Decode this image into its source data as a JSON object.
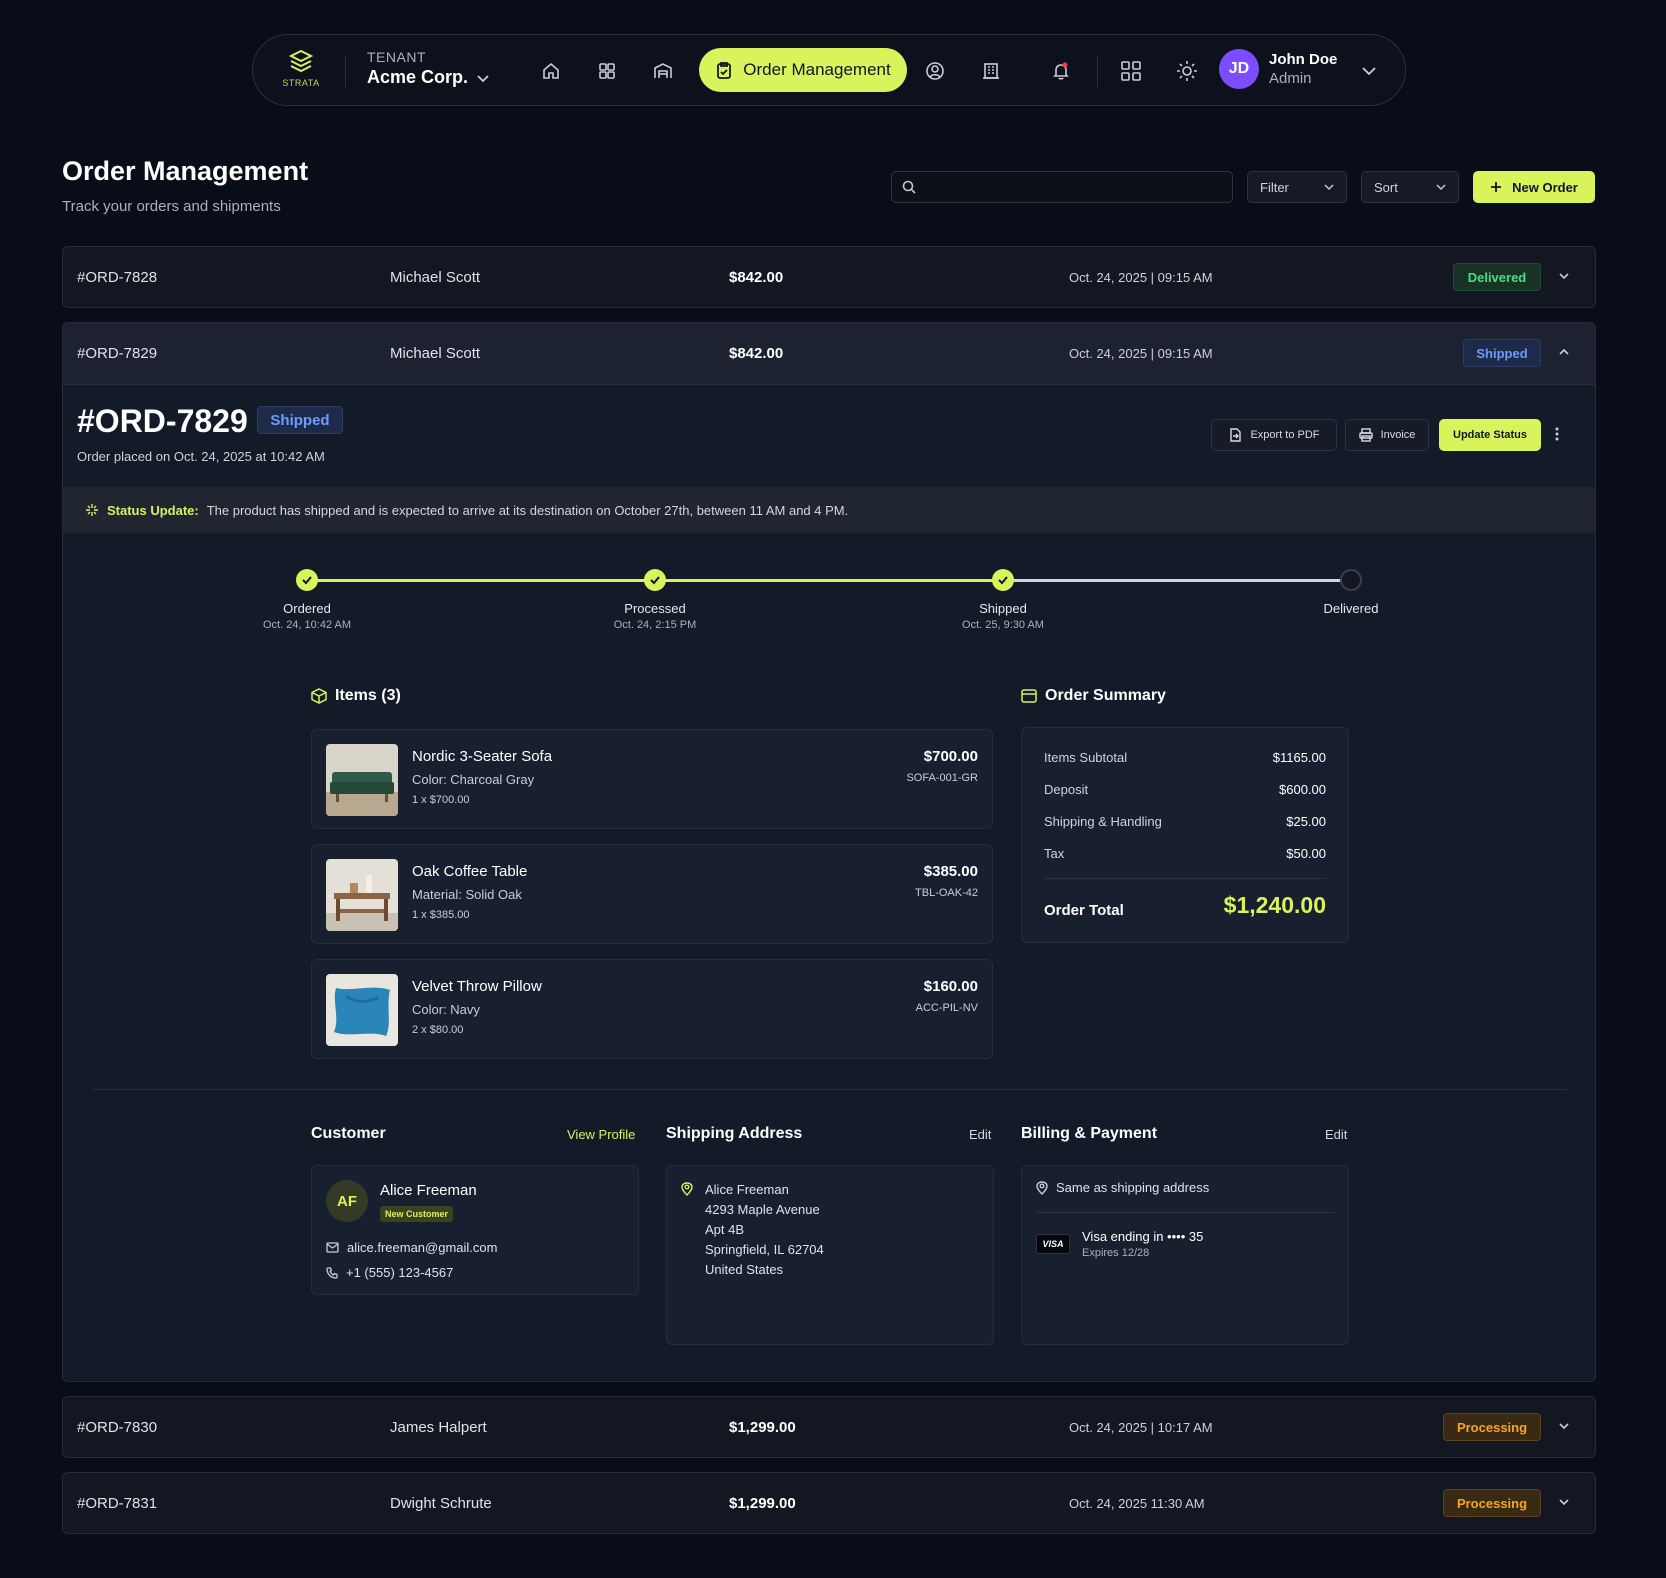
{
  "nav": {
    "logo_text": "STRATA",
    "tenant_label": "TENANT",
    "tenant_name": "Acme Corp.",
    "active_label": "Order Management",
    "user_initials": "JD",
    "user_name": "John Doe",
    "user_role": "Admin",
    "accent": "#d9f35a"
  },
  "page": {
    "title": "Order Management",
    "subtitle": "Track your orders and shipments",
    "search_placeholder": "",
    "filter_label": "Filter",
    "sort_label": "Sort",
    "new_order_label": "New Order"
  },
  "orders": [
    {
      "id": "#ORD-7828",
      "customer": "Michael Scott",
      "amount": "$842.00",
      "date": "Oct. 24, 2025 | 09:15 AM",
      "status": "Delivered"
    },
    {
      "id": "#ORD-7829",
      "customer": "Michael Scott",
      "amount": "$842.00",
      "date": "Oct. 24, 2025 | 09:15 AM",
      "status": "Shipped"
    },
    {
      "id": "#ORD-7830",
      "customer": "James Halpert",
      "amount": "$1,299.00",
      "date": "Oct. 24, 2025 | 10:17 AM",
      "status": "Processing"
    },
    {
      "id": "#ORD-7831",
      "customer": "Dwight Schrute",
      "amount": "$1,299.00",
      "date": "Oct. 24, 2025 11:30 AM",
      "status": "Processing"
    }
  ],
  "detail": {
    "id": "#ORD-7829",
    "status": "Shipped",
    "placed": "Order placed on Oct. 24, 2025 at 10:42 AM",
    "export_label": "Export to PDF",
    "invoice_label": "Invoice",
    "update_label": "Update Status",
    "status_update_label": "Status Update:",
    "status_update_text": "The product has shipped and is expected to arrive at its destination on October 27th, between 11 AM and 4 PM.",
    "steps": [
      {
        "label": "Ordered",
        "date": "Oct. 24, 10:42 AM",
        "done": true
      },
      {
        "label": "Processed",
        "date": "Oct. 24, 2:15 PM",
        "done": true
      },
      {
        "label": "Shipped",
        "date": "Oct. 25, 9:30 AM",
        "done": true
      },
      {
        "label": "Delivered",
        "date": "",
        "done": false
      }
    ],
    "items_title": "Items (3)",
    "items": [
      {
        "name": "Nordic 3-Seater Sofa",
        "attr": "Color: Charcoal Gray",
        "qty": "1 x $700.00",
        "price": "$700.00",
        "sku": "SOFA-001-GR"
      },
      {
        "name": "Oak Coffee Table",
        "attr": "Material: Solid Oak",
        "qty": "1 x $385.00",
        "price": "$385.00",
        "sku": "TBL-OAK-42"
      },
      {
        "name": "Velvet Throw Pillow",
        "attr": "Color: Navy",
        "qty": "2 x $80.00",
        "price": "$160.00",
        "sku": "ACC-PIL-NV"
      }
    ],
    "summary_title": "Order Summary",
    "summary": [
      {
        "label": "Items Subtotal",
        "value": "$1165.00"
      },
      {
        "label": "Deposit",
        "value": "$600.00"
      },
      {
        "label": "Shipping & Handling",
        "value": "$25.00"
      },
      {
        "label": "Tax",
        "value": "$50.00"
      }
    ],
    "total_label": "Order Total",
    "total_value": "$1,240.00",
    "customer": {
      "title": "Customer",
      "view_profile": "View Profile",
      "initials": "AF",
      "name": "Alice Freeman",
      "tag": "New Customer",
      "email": "alice.freeman@gmail.com",
      "phone": "+1 (555) 123-4567"
    },
    "shipping": {
      "title": "Shipping Address",
      "edit": "Edit",
      "name": "Alice Freeman",
      "line1": "4293 Maple Avenue",
      "line2": "Apt 4B",
      "line3": "Springfield, IL 62704",
      "line4": "United States"
    },
    "billing": {
      "title": "Billing & Payment",
      "edit": "Edit",
      "same": "Same as shipping address",
      "card_brand": "VISA",
      "card": "Visa ending in •••• 35",
      "expires": "Expires 12/28"
    }
  }
}
